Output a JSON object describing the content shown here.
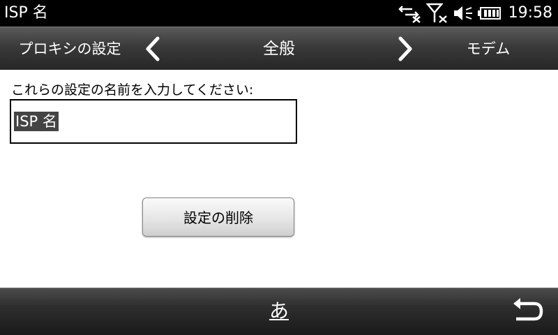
{
  "status_bar": {
    "title": "ISP 名",
    "time": "19:58",
    "icons": [
      "data-disconnected-icon",
      "no-signal-icon",
      "speaker-muted-icon",
      "battery-icon"
    ]
  },
  "tabs": {
    "prev_label": "プロキシの設定",
    "current_label": "全般",
    "next_label": "モデム"
  },
  "form": {
    "prompt": "これらの設定の名前を入力してください:",
    "name_value": "ISP 名"
  },
  "actions": {
    "delete_label": "設定の削除"
  },
  "bottom_bar": {
    "ime_label": "あ",
    "back_icon": "back-arrow-icon"
  }
}
